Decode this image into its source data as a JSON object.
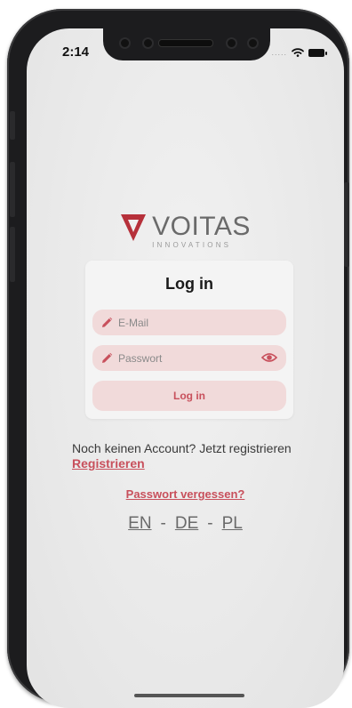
{
  "status_bar": {
    "time": "2:14",
    "signal_dots": "....."
  },
  "logo": {
    "name": "VOITAS",
    "subtitle": "INNOVATIONS",
    "mark_color": "#b6303a"
  },
  "login_card": {
    "title": "Log in",
    "email_placeholder": "E-Mail",
    "password_placeholder": "Passwort",
    "submit_label": "Log in"
  },
  "links": {
    "no_account_text": "Noch keinen Account? Jetzt registrieren",
    "register_label": "Registrieren",
    "forgot_password_label": "Passwort vergessen?"
  },
  "languages": {
    "items": [
      "EN",
      "DE",
      "PL"
    ],
    "separator": "-"
  },
  "colors": {
    "accent": "#c8505c",
    "field_bg": "#f1dada",
    "card_bg": "#f4f4f4"
  }
}
